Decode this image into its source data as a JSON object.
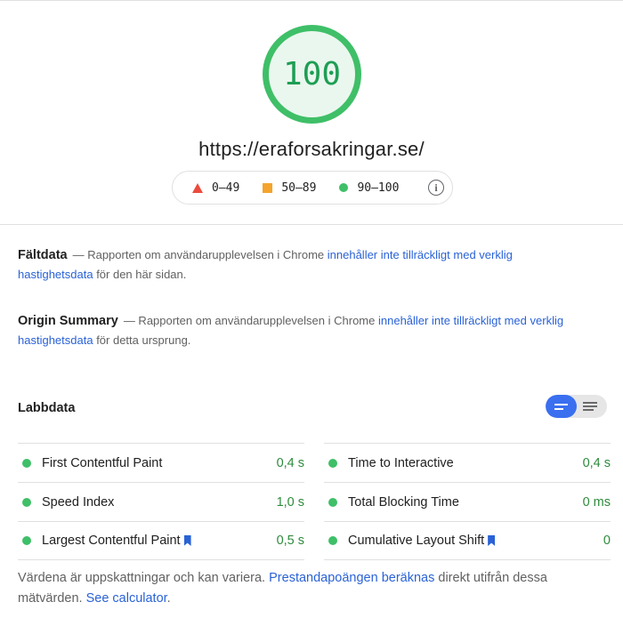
{
  "score": {
    "value": "100",
    "fraction": 1.0,
    "color": "#3fbf68"
  },
  "url": "https://eraforsakringar.se/",
  "legend": {
    "fail_label": "0–49",
    "average_label": "50–89",
    "pass_label": "90–100",
    "fail_color": "#eb4b3d",
    "average_color": "#f4a42b",
    "pass_color": "#3fbf68",
    "info_icon": "info-icon"
  },
  "field_data": {
    "title": "Fältdata",
    "text_before": "— Rapporten om användarupplevelsen i Chrome ",
    "link": "innehåller inte tillräckligt med verklig hastighetsdata",
    "text_after": " för den här sidan."
  },
  "origin_summary": {
    "title": "Origin Summary",
    "text_before": "— Rapporten om användarupplevelsen i Chrome ",
    "link": "innehåller inte tillräckligt med verklig hastighetsdata",
    "text_after": " för detta ursprung."
  },
  "lab_data": {
    "title": "Labbdata",
    "toggle_selected": "compact-view",
    "metrics_left": [
      {
        "name": "First Contentful Paint",
        "value": "0,4 s",
        "bookmark": false
      },
      {
        "name": "Speed Index",
        "value": "1,0 s",
        "bookmark": false
      },
      {
        "name": "Largest Contentful Paint",
        "value": "0,5 s",
        "bookmark": true
      }
    ],
    "metrics_right": [
      {
        "name": "Time to Interactive",
        "value": "0,4 s",
        "bookmark": false
      },
      {
        "name": "Total Blocking Time",
        "value": "0 ms",
        "bookmark": false
      },
      {
        "name": "Cumulative Layout Shift",
        "value": "0",
        "bookmark": true
      }
    ],
    "pass_color": "#3fbf68",
    "value_color": "#2e8b3c"
  },
  "footer": {
    "text_before": "Värdena är uppskattningar och kan variera. ",
    "link1": "Prestandapoängen beräknas",
    "text_middle": " direkt utifrån dessa mätvärden. ",
    "link2": "See calculator",
    "text_after": "."
  },
  "link_color": "#2a62d6"
}
